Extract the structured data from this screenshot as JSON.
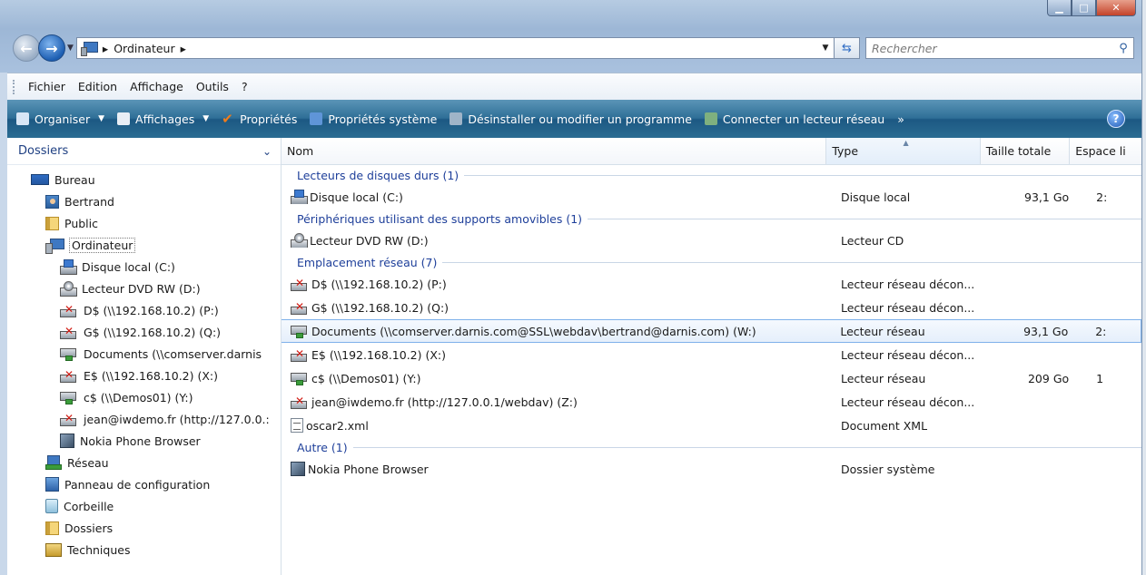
{
  "window": {
    "caption": {
      "minimize": "▁",
      "maximize": "□",
      "close": "✕"
    }
  },
  "address": {
    "crumbs": [
      "Ordinateur"
    ],
    "search_placeholder": "Rechercher"
  },
  "menu": [
    "Fichier",
    "Edition",
    "Affichage",
    "Outils",
    "?"
  ],
  "toolbar": {
    "items": [
      {
        "label": "Organiser",
        "dropdown": true,
        "icon": "organize-icon",
        "color": "#d8e6f5"
      },
      {
        "label": "Affichages",
        "dropdown": true,
        "icon": "views-icon",
        "color": "#e8eef5"
      },
      {
        "label": "Propriétés",
        "dropdown": false,
        "icon": "checkmark-icon",
        "color": "#f07c1a"
      },
      {
        "label": "Propriétés système",
        "dropdown": false,
        "icon": "system-properties-icon",
        "color": "#5f95d8"
      },
      {
        "label": "Désinstaller ou modifier un programme",
        "dropdown": false,
        "icon": "uninstall-icon",
        "color": "#9fb4c8"
      },
      {
        "label": "Connecter un lecteur réseau",
        "dropdown": false,
        "icon": "network-drive-icon",
        "color": "#7fb07f"
      }
    ],
    "more": "»",
    "help": "?"
  },
  "navpane": {
    "title": "Dossiers",
    "tree": [
      {
        "label": "Bureau",
        "icon": "desk",
        "indent": 0
      },
      {
        "label": "Bertrand",
        "icon": "user",
        "indent": 1
      },
      {
        "label": "Public",
        "icon": "folder",
        "indent": 1
      },
      {
        "label": "Ordinateur",
        "icon": "pc",
        "indent": 1,
        "selected": true
      },
      {
        "label": "Disque local (C:)",
        "icon": "hdd",
        "indent": 2
      },
      {
        "label": "Lecteur DVD RW (D:)",
        "icon": "dvd",
        "indent": 2
      },
      {
        "label": "D$ (\\\\192.168.10.2) (P:)",
        "icon": "netx",
        "indent": 2
      },
      {
        "label": "G$ (\\\\192.168.10.2) (Q:)",
        "icon": "netx",
        "indent": 2
      },
      {
        "label": "Documents (\\\\comserver.darnis",
        "icon": "net",
        "indent": 2
      },
      {
        "label": "E$ (\\\\192.168.10.2) (X:)",
        "icon": "netx",
        "indent": 2
      },
      {
        "label": "c$ (\\\\Demos01) (Y:)",
        "icon": "net",
        "indent": 2
      },
      {
        "label": "jean@iwdemo.fr (http://127.0.0.:",
        "icon": "netx",
        "indent": 2
      },
      {
        "label": "Nokia Phone Browser",
        "icon": "phone",
        "indent": 2
      },
      {
        "label": "Réseau",
        "icon": "netw",
        "indent": 1
      },
      {
        "label": "Panneau de configuration",
        "icon": "panel",
        "indent": 1
      },
      {
        "label": "Corbeille",
        "icon": "bin",
        "indent": 1
      },
      {
        "label": "Dossiers",
        "icon": "folder",
        "indent": 1
      },
      {
        "label": "Techniques",
        "icon": "tech",
        "indent": 1
      }
    ]
  },
  "columns": [
    "Nom",
    "Type",
    "Taille totale",
    "Espace li"
  ],
  "groups": [
    {
      "title": "Lecteurs de disques durs (1)",
      "rows": [
        {
          "name": "Disque local (C:)",
          "icon": "hdd",
          "type": "Disque local",
          "size": "93,1 Go",
          "free": "2:"
        }
      ]
    },
    {
      "title": "Périphériques utilisant des supports amovibles (1)",
      "rows": [
        {
          "name": "Lecteur DVD RW (D:)",
          "icon": "dvd",
          "type": "Lecteur CD",
          "size": "",
          "free": ""
        }
      ]
    },
    {
      "title": "Emplacement réseau (7)",
      "rows": [
        {
          "name": "D$ (\\\\192.168.10.2) (P:)",
          "icon": "netx",
          "type": "Lecteur réseau décon...",
          "size": "",
          "free": ""
        },
        {
          "name": "G$ (\\\\192.168.10.2) (Q:)",
          "icon": "netx",
          "type": "Lecteur réseau décon...",
          "size": "",
          "free": ""
        },
        {
          "name": "Documents (\\\\comserver.darnis.com@SSL\\webdav\\bertrand@darnis.com) (W:)",
          "icon": "net",
          "type": "Lecteur réseau",
          "size": "93,1 Go",
          "free": "2:",
          "highlight": true
        },
        {
          "name": "E$ (\\\\192.168.10.2) (X:)",
          "icon": "netx",
          "type": "Lecteur réseau décon...",
          "size": "",
          "free": ""
        },
        {
          "name": "c$ (\\\\Demos01) (Y:)",
          "icon": "net",
          "type": "Lecteur réseau",
          "size": "209 Go",
          "free": "1"
        },
        {
          "name": "jean@iwdemo.fr (http://127.0.0.1/webdav) (Z:)",
          "icon": "netx",
          "type": "Lecteur réseau décon...",
          "size": "",
          "free": ""
        },
        {
          "name": "oscar2.xml",
          "icon": "xml",
          "type": "Document XML",
          "size": "",
          "free": ""
        }
      ]
    },
    {
      "title": "Autre (1)",
      "rows": [
        {
          "name": "Nokia Phone Browser",
          "icon": "phone",
          "type": "Dossier système",
          "size": "",
          "free": ""
        }
      ]
    }
  ]
}
